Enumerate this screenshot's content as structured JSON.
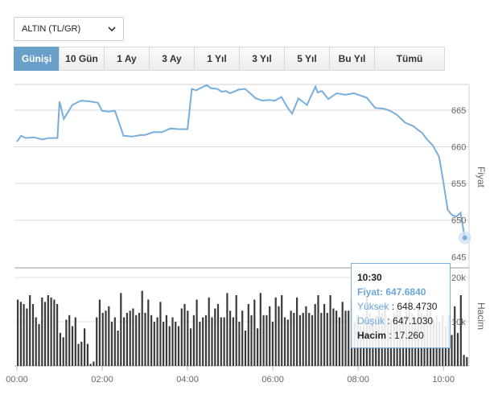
{
  "instrument_select": {
    "value": "ALTIN (TL/GR)",
    "icon": "chevron-down-icon"
  },
  "period_tabs": [
    {
      "label": "Günişi",
      "active": true
    },
    {
      "label": "10 Gün",
      "active": false
    },
    {
      "label": "1 Ay",
      "active": false
    },
    {
      "label": "3 Ay",
      "active": false
    },
    {
      "label": "1 Yıl",
      "active": false
    },
    {
      "label": "3 Yıl",
      "active": false
    },
    {
      "label": "5 Yıl",
      "active": false
    },
    {
      "label": "Bu Yıl",
      "active": false
    },
    {
      "label": "Tümü",
      "active": false
    }
  ],
  "tooltip": {
    "time": "10:30",
    "price_label": "Fiyat",
    "price_value": "647.6840",
    "high_label": "Yüksek",
    "high_value": "648.4730",
    "low_label": "Düşük",
    "low_value": "647.1030",
    "volume_label": "Hacim",
    "volume_value": "17.260"
  },
  "colors": {
    "accent": "#6a9fc9",
    "line": "#78aedc",
    "bars": "#3a3a3a",
    "tooltip_border": "#7ab0db"
  },
  "chart_data": [
    {
      "type": "line",
      "ylabel": "Fiyat",
      "ylim": [
        643.5,
        668.5
      ],
      "y_ticks": [
        645,
        650,
        655,
        660,
        665
      ],
      "x_ticks": [
        "00:00",
        "02:00",
        "04:00",
        "06:00",
        "08:00",
        "10:00"
      ],
      "x_range_hours": [
        0,
        10.6
      ],
      "series": [
        {
          "x": [
            0,
            0.1,
            0.2,
            0.4,
            0.6,
            0.75,
            0.95,
            1.0,
            1.1,
            1.3,
            1.5,
            1.7,
            1.9,
            2.0,
            2.15,
            2.3,
            2.5,
            2.7,
            2.9,
            3.0,
            3.2,
            3.4,
            3.6,
            3.8,
            4.0,
            4.1,
            4.2,
            4.3,
            4.45,
            4.55,
            4.7,
            4.8,
            4.9,
            5.0,
            5.2,
            5.35,
            5.6,
            5.75,
            5.9,
            6.05,
            6.2,
            6.35,
            6.45,
            6.6,
            6.8,
            7.0,
            7.05,
            7.15,
            7.3,
            7.5,
            7.7,
            7.9,
            8.0,
            8.2,
            8.4,
            8.6,
            8.75,
            8.9,
            9.1,
            9.3,
            9.4,
            9.5,
            9.6,
            9.75,
            9.9,
            10.0,
            10.1,
            10.2,
            10.3,
            10.4,
            10.5
          ],
          "y": [
            660.7,
            661.5,
            661.2,
            661.3,
            661.0,
            661.2,
            661.2,
            666.2,
            663.8,
            665.7,
            666.3,
            666.2,
            666.0,
            664.9,
            664.8,
            664.9,
            661.5,
            661.4,
            661.6,
            661.6,
            662.0,
            662.0,
            662.5,
            662.4,
            662.4,
            667.9,
            667.7,
            668.0,
            668.4,
            668.0,
            667.9,
            667.5,
            667.6,
            667.3,
            667.8,
            667.9,
            666.6,
            666.3,
            666.4,
            666.3,
            666.8,
            665.3,
            664.5,
            666.6,
            665.7,
            668.2,
            667.4,
            667.6,
            666.5,
            667.3,
            667.1,
            667.3,
            667.1,
            666.7,
            665.3,
            665.2,
            664.9,
            664.4,
            663.3,
            662.8,
            662.3,
            661.9,
            661.1,
            660.2,
            658.6,
            655.1,
            651.4,
            650.7,
            650.5,
            651.0,
            647.6
          ]
        }
      ]
    },
    {
      "type": "bar",
      "ylabel": "Hacim",
      "y_ticks": [
        "20k",
        "10k"
      ],
      "ylim": [
        0,
        22000
      ],
      "note": "volume per interval",
      "values": [
        15000,
        14500,
        14000,
        13000,
        16000,
        14000,
        11000,
        9500,
        15500,
        14500,
        16000,
        15500,
        15000,
        14000,
        7500,
        6500,
        10500,
        11500,
        9000,
        11000,
        5000,
        5500,
        8500,
        5000,
        500,
        1000,
        11000,
        15000,
        12000,
        12500,
        13500,
        10000,
        11000,
        8000,
        16500,
        11000,
        12000,
        12500,
        13000,
        11500,
        12000,
        17000,
        12000,
        15000,
        11500,
        10000,
        11000,
        14500,
        10000,
        11500,
        9000,
        11000,
        10000,
        9000,
        13000,
        14000,
        12500,
        8500,
        11500,
        15000,
        10000,
        11000,
        11500,
        15500,
        11000,
        13000,
        14000,
        11000,
        11000,
        16500,
        12500,
        11000,
        16000,
        10000,
        12500,
        8000,
        14000,
        11500,
        15000,
        8500,
        16500,
        11500,
        11500,
        13500,
        10000,
        15500,
        13500,
        16000,
        11000,
        10500,
        12500,
        12000,
        15500,
        11500,
        12000,
        13500,
        12000,
        11500,
        14000,
        16000,
        12000,
        14000,
        12000,
        16000,
        13000,
        12500,
        11000,
        14500,
        12500,
        12500,
        15000,
        10000,
        11500,
        9000,
        10500,
        15500,
        12000,
        11000,
        10500,
        13500,
        12000,
        14000,
        11000,
        10500,
        12000,
        13000,
        12500,
        11000,
        12500,
        15000,
        12000,
        10000,
        14500,
        12000,
        11500,
        13000,
        12500,
        10500,
        11500,
        10000,
        11500,
        9000,
        11500,
        7000,
        13500,
        7500,
        16000,
        2500,
        2000
      ]
    }
  ]
}
